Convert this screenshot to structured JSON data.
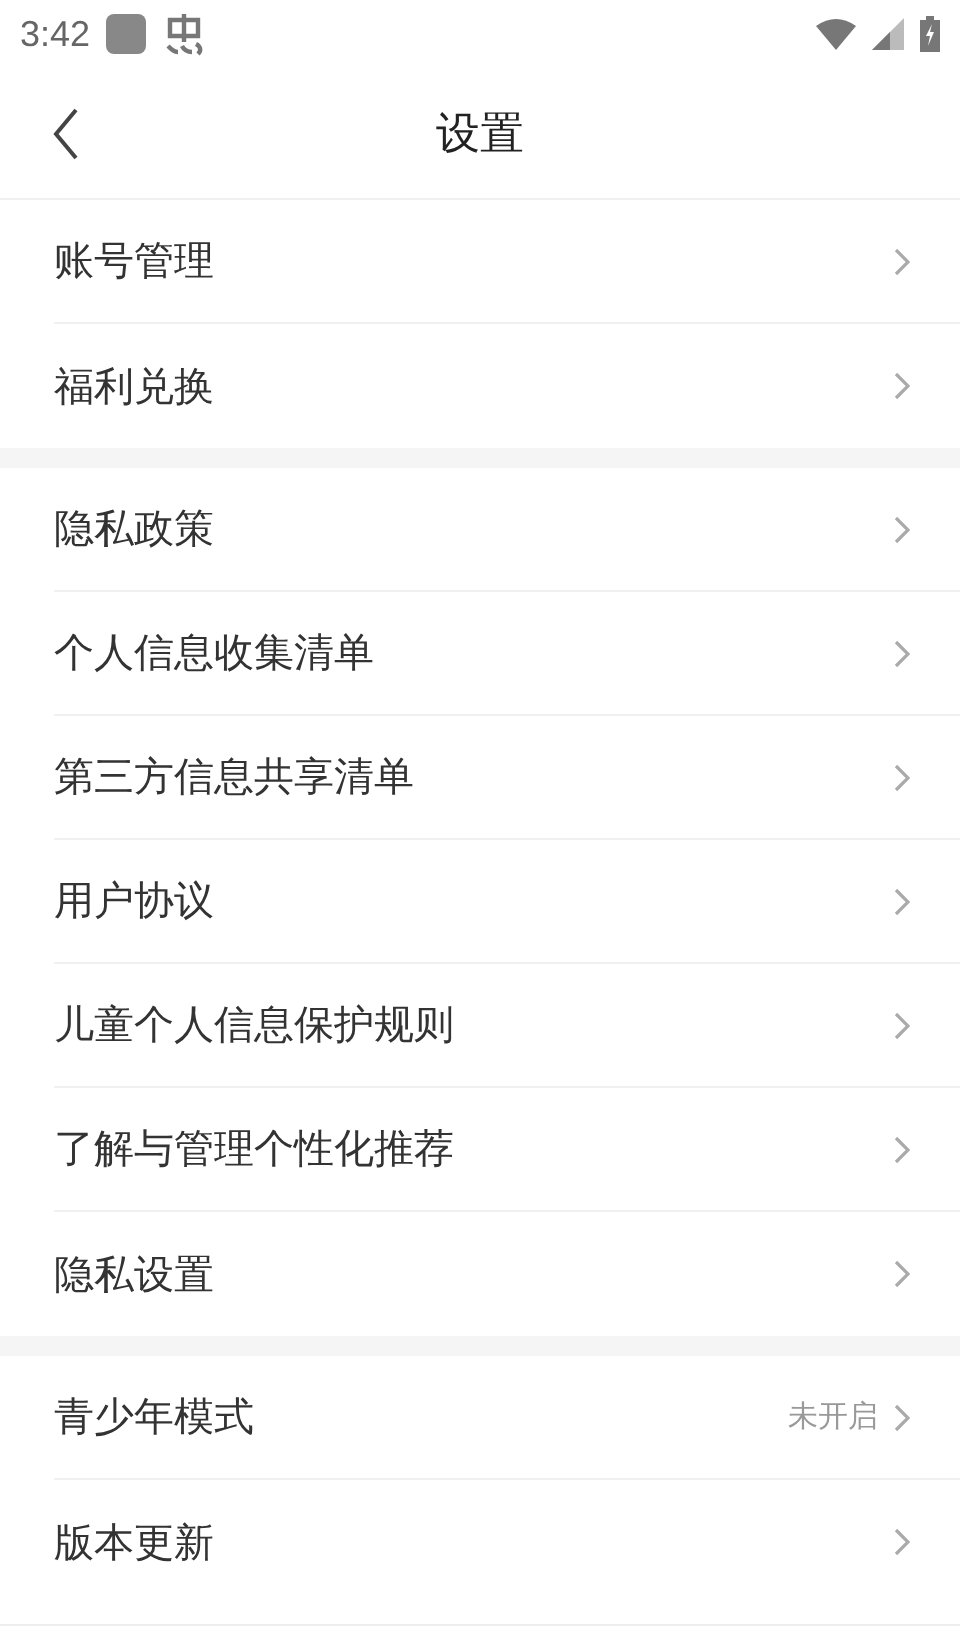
{
  "status_bar": {
    "time": "3:42"
  },
  "header": {
    "title": "设置"
  },
  "groups": [
    {
      "items": [
        {
          "label": "账号管理"
        },
        {
          "label": "福利兑换"
        }
      ]
    },
    {
      "items": [
        {
          "label": "隐私政策"
        },
        {
          "label": "个人信息收集清单"
        },
        {
          "label": "第三方信息共享清单"
        },
        {
          "label": "用户协议"
        },
        {
          "label": "儿童个人信息保护规则"
        },
        {
          "label": "了解与管理个性化推荐"
        },
        {
          "label": "隐私设置"
        }
      ]
    },
    {
      "items": [
        {
          "label": "青少年模式",
          "value": "未开启"
        },
        {
          "label": "版本更新"
        }
      ]
    }
  ]
}
